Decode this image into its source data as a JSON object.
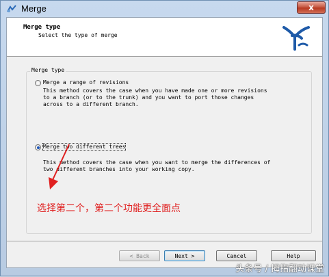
{
  "window": {
    "title": "Merge",
    "close_glyph": "x"
  },
  "header": {
    "title": "Merge type",
    "subtitle": "Select the type of merge",
    "logo_icon": "tortoisesvn-logo-icon"
  },
  "group": {
    "label": "Merge type"
  },
  "options": [
    {
      "label": "Merge a range of revisions",
      "mnemonic": "r",
      "selected": false,
      "description": "This method covers the case when you have made one or more revisions\nto a branch (or to the trunk) and you want to port those changes\nacross to a different branch."
    },
    {
      "label": "Merge two different trees",
      "mnemonic": "t",
      "selected": true,
      "description": "This method covers the case when you want to merge the differences of\ntwo different branches into your working copy."
    }
  ],
  "annotation": {
    "text": "选择第二个，第二个功能更全面点",
    "color": "#e02020"
  },
  "buttons": {
    "back": "< Back",
    "next": "Next >",
    "cancel": "Cancel",
    "help": "Help"
  },
  "watermark": "头条号 / 拇指翻动课堂"
}
